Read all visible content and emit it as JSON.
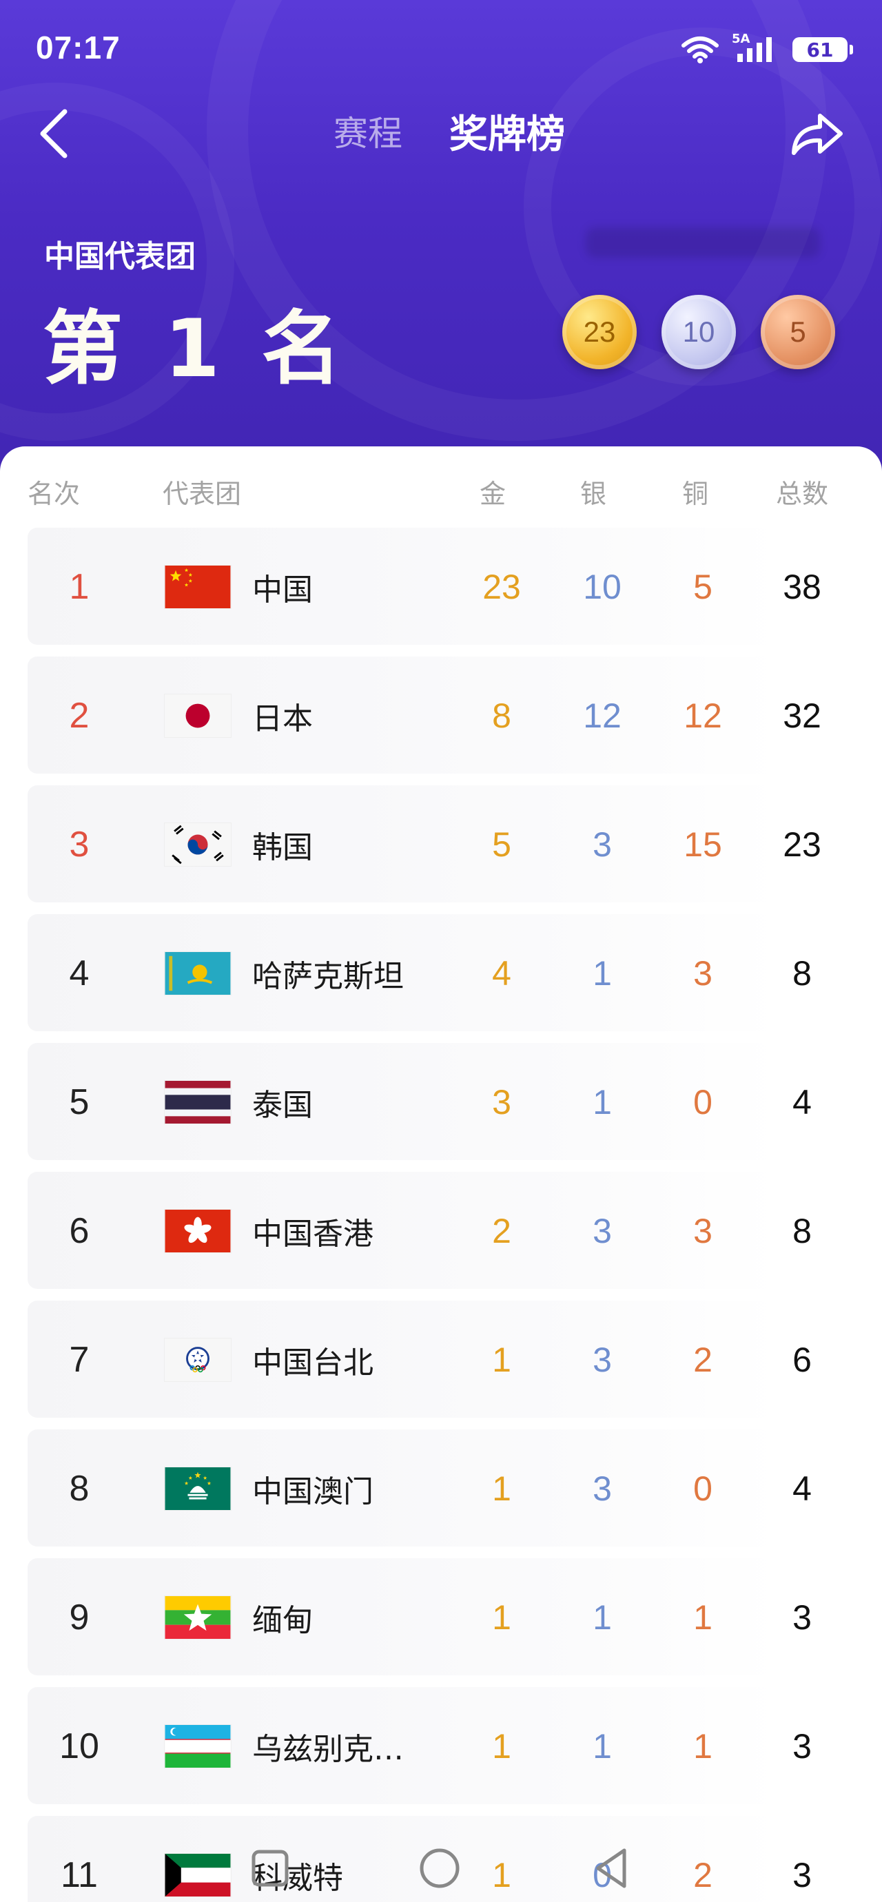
{
  "status": {
    "time": "07:17",
    "network": "5A",
    "battery": "61"
  },
  "nav": {
    "tab_schedule": "赛程",
    "tab_medals": "奖牌榜"
  },
  "summary": {
    "delegation": "中国代表团",
    "rank_text": "第 1 名",
    "gold": "23",
    "silver": "10",
    "bronze": "5"
  },
  "columns": {
    "rank": "名次",
    "team": "代表团",
    "gold": "金",
    "silver": "银",
    "bronze": "铜",
    "total": "总数"
  },
  "rows": [
    {
      "rank": "1",
      "flag": "flag-china-icon",
      "name": "中国",
      "gold": "23",
      "silver": "10",
      "bronze": "5",
      "total": "38"
    },
    {
      "rank": "2",
      "flag": "flag-japan-icon",
      "name": "日本",
      "gold": "8",
      "silver": "12",
      "bronze": "12",
      "total": "32"
    },
    {
      "rank": "3",
      "flag": "flag-korea-icon",
      "name": "韩国",
      "gold": "5",
      "silver": "3",
      "bronze": "15",
      "total": "23"
    },
    {
      "rank": "4",
      "flag": "flag-kazakhstan-icon",
      "name": "哈萨克斯坦",
      "gold": "4",
      "silver": "1",
      "bronze": "3",
      "total": "8"
    },
    {
      "rank": "5",
      "flag": "flag-thailand-icon",
      "name": "泰国",
      "gold": "3",
      "silver": "1",
      "bronze": "0",
      "total": "4"
    },
    {
      "rank": "6",
      "flag": "flag-hongkong-icon",
      "name": "中国香港",
      "gold": "2",
      "silver": "3",
      "bronze": "3",
      "total": "8"
    },
    {
      "rank": "7",
      "flag": "flag-chinese-taipei-icon",
      "name": "中国台北",
      "gold": "1",
      "silver": "3",
      "bronze": "2",
      "total": "6"
    },
    {
      "rank": "8",
      "flag": "flag-macao-icon",
      "name": "中国澳门",
      "gold": "1",
      "silver": "3",
      "bronze": "0",
      "total": "4"
    },
    {
      "rank": "9",
      "flag": "flag-myanmar-icon",
      "name": "缅甸",
      "gold": "1",
      "silver": "1",
      "bronze": "1",
      "total": "3"
    },
    {
      "rank": "10",
      "flag": "flag-uzbekistan-icon",
      "name": "乌兹别克…",
      "gold": "1",
      "silver": "1",
      "bronze": "1",
      "total": "3"
    },
    {
      "rank": "11",
      "flag": "flag-kuwait-icon",
      "name": "科威特",
      "gold": "1",
      "silver": "0",
      "bronze": "2",
      "total": "3"
    }
  ],
  "colors": {
    "header_bg": "#4b2bc4",
    "gold": "#e4a020",
    "silver": "#6f8ecf",
    "bronze": "#e07840",
    "top_rank": "#e05040"
  }
}
